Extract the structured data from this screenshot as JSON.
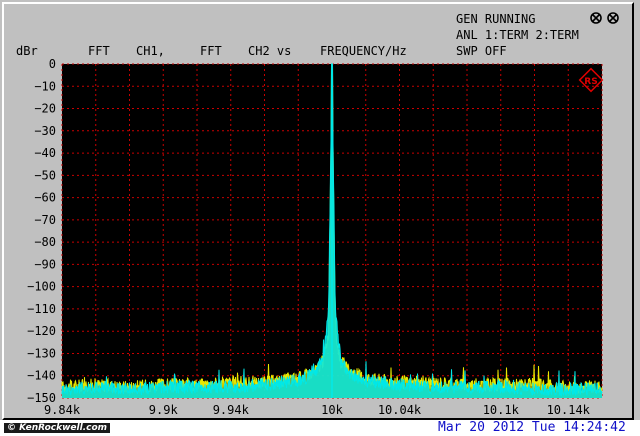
{
  "status": {
    "gen": "GEN RUNNING",
    "anl": "ANL 1:TERM 2:TERM",
    "swp": "SWP OFF"
  },
  "header": {
    "unit": "dBr",
    "trace1": "FFT",
    "ch1": "CH1,",
    "trace2": "FFT",
    "ch2": "CH2 vs",
    "xaxis": "FREQUENCY/Hz"
  },
  "footer": {
    "timestamp": "Mar 20 2012 Tue 14:24:42",
    "watermark": "© KenRockwell.com"
  },
  "colors": {
    "plot_bg": "#000000",
    "grid": "#c80000",
    "ch1": "#e8e800",
    "ch2": "#00e8e8",
    "logo": "#e00000"
  },
  "icons": [
    "keyboard-lock-icon",
    "rs-logo-icon"
  ],
  "chart_data": {
    "type": "line",
    "xlabel": "FREQUENCY/Hz",
    "ylabel": "dBr",
    "xlim": [
      9840,
      10160
    ],
    "ylim": [
      -150,
      0
    ],
    "y_ticks": [
      0,
      -10,
      -20,
      -30,
      -40,
      -50,
      -60,
      -70,
      -80,
      -90,
      -100,
      -110,
      -120,
      -130,
      -140,
      -150
    ],
    "y_tick_labels": [
      "0",
      "−10",
      "−20",
      "−30",
      "−40",
      "−50",
      "−60",
      "−70",
      "−80",
      "−90",
      "−100",
      "−110",
      "−120",
      "−130",
      "−140",
      "−150"
    ],
    "x_ticks": [
      9840,
      9900,
      9940,
      10000,
      10040,
      10100,
      10140
    ],
    "x_tick_labels": [
      "9.84k",
      "9.9k",
      "9.94k",
      "10k",
      "10.04k",
      "10.1k",
      "10.14k"
    ],
    "grid": true,
    "series": [
      {
        "name": "FFT CH1",
        "color": "#e8e800",
        "noise_floor": -143,
        "x": [
          9840,
          9860,
          9880,
          9900,
          9920,
          9940,
          9960,
          9980,
          9990,
          9995,
          9998,
          10000,
          10002,
          10005,
          10010,
          10020,
          10040,
          10060,
          10080,
          10100,
          10120,
          10140,
          10160
        ],
        "y": [
          -145,
          -144,
          -145,
          -144,
          -144,
          -143,
          -143,
          -141,
          -138,
          -133,
          -120,
          0,
          -120,
          -133,
          -138,
          -141,
          -143,
          -143,
          -144,
          -144,
          -144,
          -145,
          -145
        ]
      },
      {
        "name": "FFT CH2",
        "color": "#00e8e8",
        "noise_floor": -145,
        "x": [
          9840,
          9860,
          9880,
          9900,
          9920,
          9940,
          9960,
          9980,
          9990,
          9995,
          9998,
          10000,
          10002,
          10005,
          10010,
          10020,
          10040,
          10060,
          10080,
          10100,
          10120,
          10140,
          10160
        ],
        "y": [
          -146,
          -145,
          -146,
          -145,
          -145,
          -145,
          -144,
          -142,
          -139,
          -132,
          -110,
          0,
          -112,
          -132,
          -139,
          -142,
          -144,
          -145,
          -145,
          -145,
          -146,
          -146,
          -146
        ]
      }
    ]
  }
}
